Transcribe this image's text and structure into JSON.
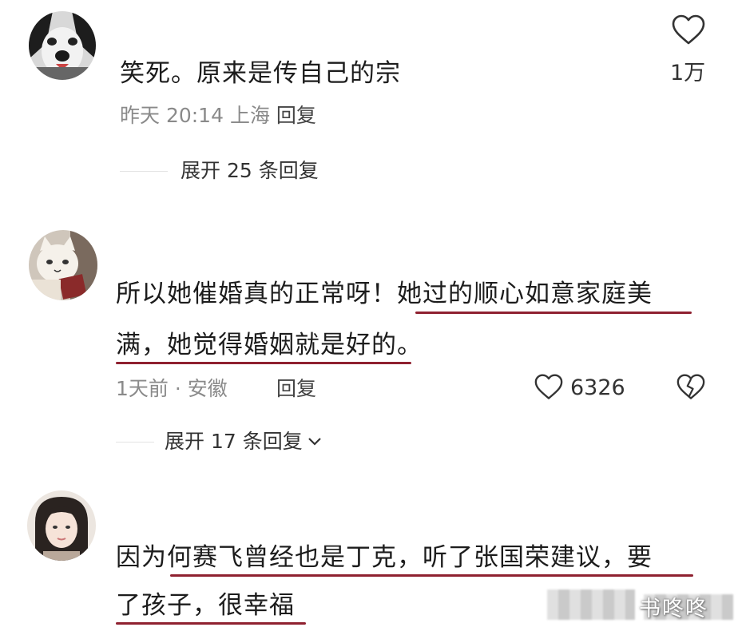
{
  "comments": [
    {
      "text": "笑死。原来是传自己的宗",
      "meta_time": "昨天 20:14",
      "meta_location": "上海",
      "reply_label": "回复",
      "like_count": "1万",
      "expand_label": "展开 25 条回复"
    },
    {
      "text_line1_a": "所以她催婚真的正常呀！",
      "text_line1_b": "她过的顺心如意家庭美",
      "text_line2": "满，她觉得婚姻就是好的。",
      "meta_time": "1天前 · 安徽",
      "reply_label": "回复",
      "like_count": "6326",
      "expand_label": "展开 17 条回复"
    },
    {
      "text_line1": "因为何赛飞曾经也是丁克，听了张国荣建议，要",
      "text_line2": "了孩子，很幸福"
    }
  ],
  "watermark": "书咚咚",
  "colors": {
    "underline": "#8f2130",
    "meta": "#8a8a8a",
    "text": "#1c1c1c"
  },
  "icons": {
    "like": "heart-outline-icon",
    "dislike": "broken-heart-icon",
    "expand": "chevron-down-icon"
  }
}
